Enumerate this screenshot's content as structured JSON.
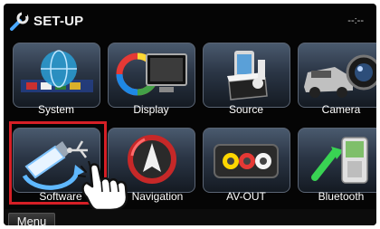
{
  "header": {
    "title": "SET-UP",
    "clock": "--:--"
  },
  "tiles": [
    {
      "label": "System",
      "icon": "globe-network-icon"
    },
    {
      "label": "Display",
      "icon": "monitor-colorwheel-icon"
    },
    {
      "label": "Source",
      "icon": "media-source-icon"
    },
    {
      "label": "Camera",
      "icon": "car-camera-icon"
    },
    {
      "label": "Software",
      "icon": "usb-update-icon"
    },
    {
      "label": "Navigation",
      "icon": "navigation-arrow-icon"
    },
    {
      "label": "AV-OUT",
      "icon": "av-cable-icon"
    },
    {
      "label": "Bluetooth",
      "icon": "bluetooth-phone-icon"
    }
  ],
  "footer": {
    "menu_label": "Menu"
  },
  "colors": {
    "screen_bg": "#050505",
    "highlight": "#d61f26",
    "tile_top": "#4a5a6e"
  }
}
